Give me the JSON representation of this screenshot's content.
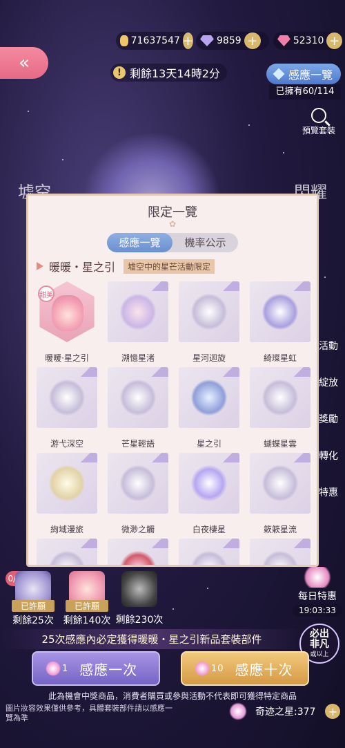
{
  "currencies": {
    "coins": "71637547",
    "diamonds": "9859",
    "stars": "52310",
    "plus": "+"
  },
  "back_icon": "«",
  "timer": {
    "icon": "!",
    "text": "剩餘13天14時2分"
  },
  "collection": {
    "button": "感應一覽",
    "owned": "已擁有60/114"
  },
  "preview": {
    "label": "預覽套裝"
  },
  "background_text": {
    "left": "墟空",
    "right": "閃耀"
  },
  "side_menu": [
    "活動",
    "綻放",
    "獎勵",
    "轉化",
    "特惠"
  ],
  "panel": {
    "title": "限定一覽",
    "tabs": [
      "感應一覽",
      "機率公示"
    ],
    "active_tab": 0,
    "suit_name": "暖暖・星之引",
    "suit_tag": "墟空中的星芒活動限定",
    "sweet_badge": "甜美",
    "items": [
      "暖暖·星之引",
      "溯憶星渚",
      "星河迴旋",
      "綺璨星虹",
      "游弋深空",
      "芒星輕語",
      "星之引",
      "蝴蝶星雲",
      "絢域漫旅",
      "微渺之觸",
      "白夜棲星",
      "簌簌星流",
      "",
      "",
      "",
      ""
    ]
  },
  "pity": {
    "counter": "0/17",
    "rewards": [
      {
        "badge": "已許願",
        "remaining": "剩餘25次"
      },
      {
        "badge": "已許願",
        "remaining": "剩餘140次"
      },
      {
        "badge": "",
        "remaining": "剩餘230次"
      }
    ]
  },
  "daily_deal": {
    "label": "每日特惠",
    "time": "19:03:33"
  },
  "guarantee_text": "25次感應內必定獲得暖暖・星之引新品套裝部件",
  "rare_seal": "必出非凡",
  "rare_seal_small": "或以上",
  "pull_one": {
    "count": "1",
    "label": "感應一次"
  },
  "pull_ten": {
    "count": "10",
    "label": "感應十次"
  },
  "disclaimer": "此為機會中獎商品，消費者購買或參與活動不代表即可獲得特定商品",
  "note": "圖片妝容效果僅供參考，具體套裝部件請以感應一覽為準",
  "miracle": {
    "label": "奇迹之星:377"
  },
  "colors": {
    "accent_pink": "#e56a86",
    "accent_blue": "#6a8fd0",
    "gold": "#d9b86e",
    "panel_bg": "#f8eeee"
  }
}
